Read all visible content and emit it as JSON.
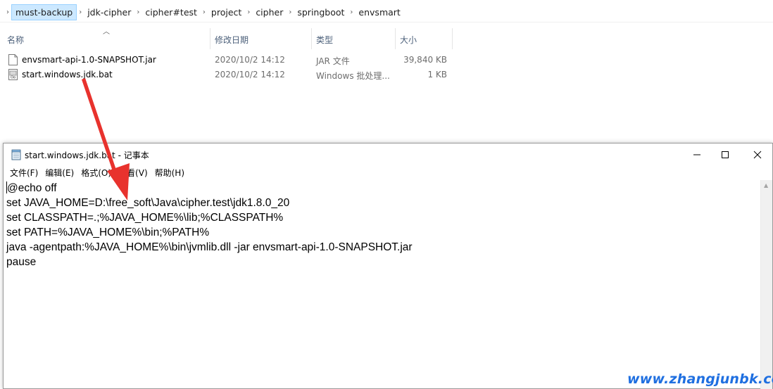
{
  "explorer": {
    "breadcrumb": [
      "must-backup",
      "jdk-cipher",
      "cipher#test",
      "project",
      "cipher",
      "springboot",
      "envsmart"
    ],
    "columns": {
      "name": "名称",
      "date": "修改日期",
      "type": "类型",
      "size": "大小"
    },
    "files": [
      {
        "name": "envsmart-api-1.0-SNAPSHOT.jar",
        "date": "2020/10/2 14:12",
        "type": "JAR 文件",
        "size": "39,840 KB",
        "icon": "jar-file-icon"
      },
      {
        "name": "start.windows.jdk.bat",
        "date": "2020/10/2 14:12",
        "type": "Windows 批处理...",
        "size": "1 KB",
        "icon": "bat-file-icon"
      }
    ]
  },
  "notepad": {
    "title": "start.windows.jdk.bat - 记事本",
    "menu": [
      "文件(F)",
      "编辑(E)",
      "格式(O)",
      "查看(V)",
      "帮助(H)"
    ],
    "lines": [
      "@echo off",
      "set JAVA_HOME=D:\\free_soft\\Java\\cipher.test\\jdk1.8.0_20",
      "set CLASSPATH=.;%JAVA_HOME%\\lib;%CLASSPATH%",
      "set PATH=%JAVA_HOME%\\bin;%PATH%",
      "java -agentpath:%JAVA_HOME%\\bin\\jvmlib.dll -jar envsmart-api-1.0-SNAPSHOT.jar",
      "pause"
    ]
  },
  "annotation": {
    "color": "#e8322d"
  },
  "watermark": "www.zhangjunbk.com"
}
